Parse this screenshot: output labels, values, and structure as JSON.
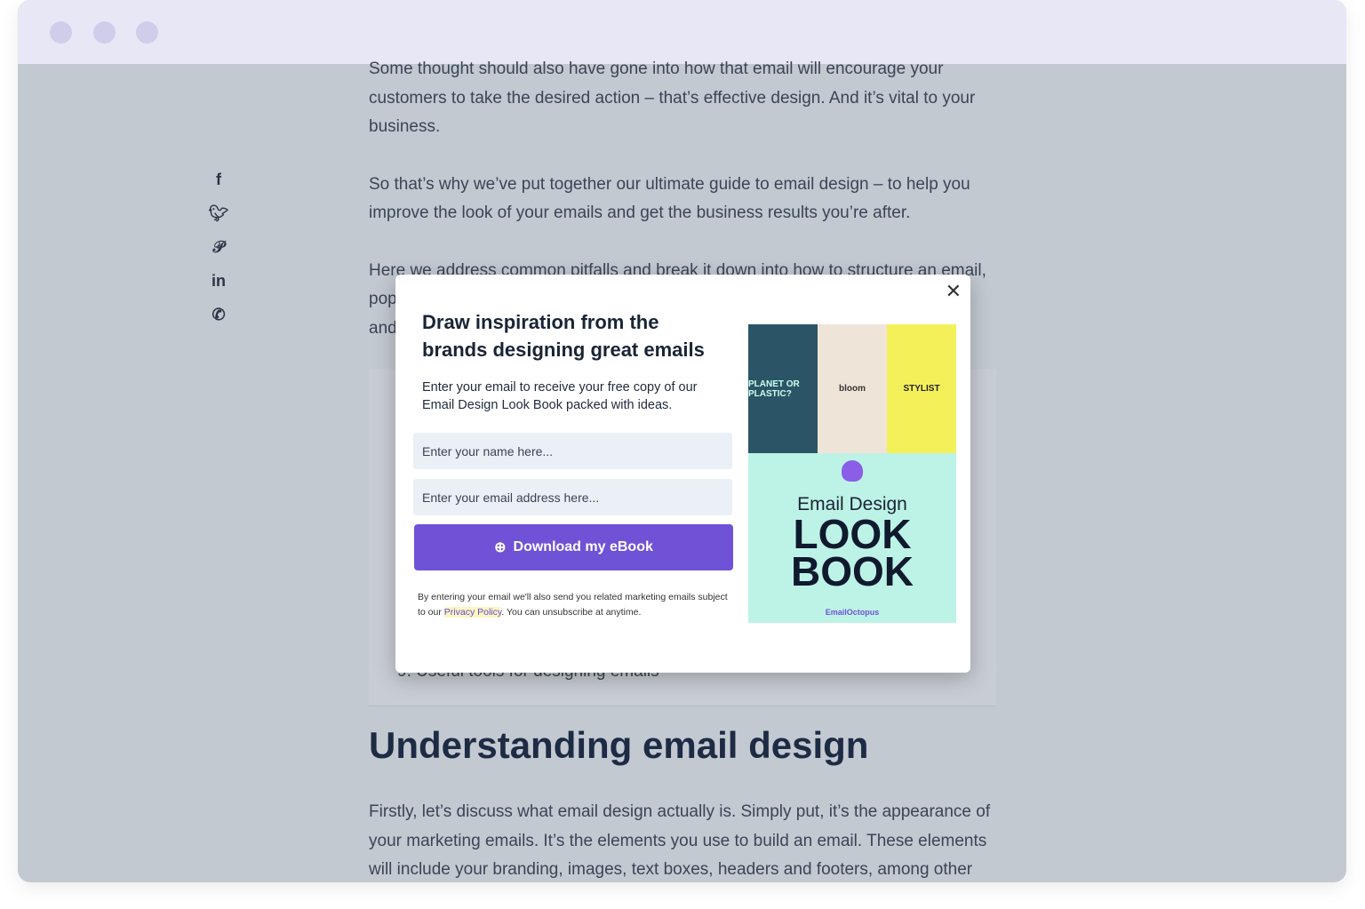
{
  "article": {
    "p1": "Some thought should also have gone into how that email will encourage your customers to take the desired action – that’s effective design. And it’s vital to your business.",
    "p2": "So that’s why we’ve put together our ultimate guide to email design – to help you improve the look of your emails and get the business results you’re after.",
    "p3": "Here we address common pitfalls and break it down into how to structure an email, pop",
    "p3b": "and",
    "toc_item": "9. Useful tools for designing emails",
    "heading": "Understanding email design",
    "p4": "Firstly, let’s discuss what email design actually is. Simply put, it’s the appearance of your marketing emails. It’s the elements you use to build an email. These elements will include your branding, images, text boxes, headers and footers, among other"
  },
  "social": [
    "facebook-icon",
    "twitter-icon",
    "pinterest-icon",
    "linkedin-icon",
    "whatsapp-icon"
  ],
  "modal": {
    "title": "Draw inspiration from the brands designing great emails",
    "description": "Enter your email to receive your free copy of our Email Design Look Book packed with ideas.",
    "name_placeholder": "Enter your name here...",
    "email_placeholder": "Enter your email address here...",
    "button": "Download my eBook",
    "fine_1": "By entering your email we'll also send you related marketing emails subject to our",
    "privacy": "Privacy Policy",
    "fine_2": ". You can unsubscribe at anytime.",
    "book": {
      "tile1": "PLANET OR PLASTIC?",
      "tile2": "bloom",
      "tile3": "STYLIST",
      "line1": "Email Design",
      "line2": "LOOK",
      "line3": "BOOK",
      "brand": "EmailOctopus"
    },
    "accent": "#6f52d6"
  }
}
